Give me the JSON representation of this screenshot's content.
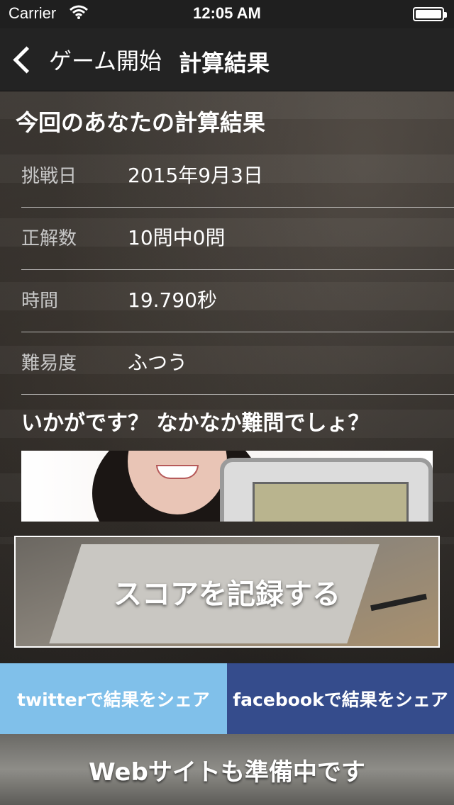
{
  "status": {
    "carrier": "Carrier",
    "time": "12:05 AM"
  },
  "nav": {
    "back_label": "ゲーム開始",
    "title": "計算結果"
  },
  "result": {
    "title": "今回のあなたの計算結果",
    "rows": [
      {
        "label": "挑戦日",
        "value": "2015年9月3日"
      },
      {
        "label": "正解数",
        "value": "10問中0問"
      },
      {
        "label": "時間",
        "value": "19.790秒"
      },
      {
        "label": "難易度",
        "value": "ふつう"
      }
    ],
    "question": "いかがです？ なかなか難問でしょ？"
  },
  "actions": {
    "record_label": "スコアを記録する",
    "twitter_label": "twitterで結果をシェア",
    "facebook_label": "facebookで結果をシェア",
    "web_label": "Webサイトも準備中です"
  },
  "colors": {
    "twitter": "#80c0ea",
    "facebook": "#354c8c"
  }
}
